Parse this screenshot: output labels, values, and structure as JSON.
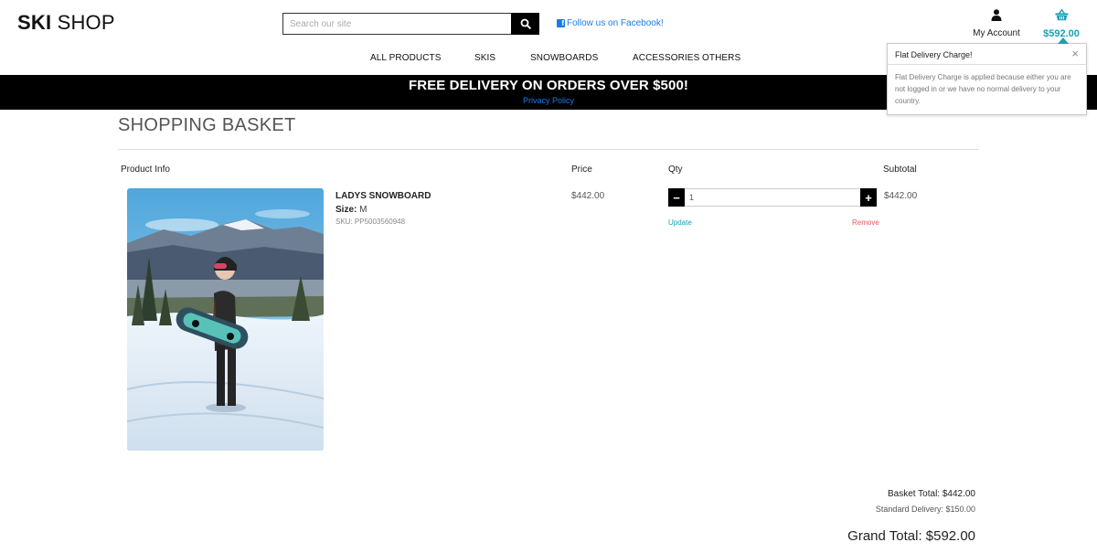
{
  "header": {
    "logo_bold": "SKI",
    "logo_normal": "SHOP",
    "search_placeholder": "Search our site",
    "facebook_label": "Follow us on Facebook!",
    "account_label": "My Account",
    "basket_total": "$592.00"
  },
  "nav": {
    "items": [
      "ALL PRODUCTS",
      "SKIS",
      "SNOWBOARDS",
      "ACCESSORIES",
      "OTHERS"
    ]
  },
  "banner": {
    "message": "FREE DELIVERY ON ORDERS OVER $500!",
    "link": "Privacy Policy"
  },
  "toast": {
    "title": "Flat Delivery Charge!",
    "close": "×",
    "body": "Flat Delivery Charge is applied because either you are not logged in or we have no normal delivery to your country."
  },
  "page": {
    "title": "SHOPPING BASKET"
  },
  "table": {
    "headers": {
      "product": "Product Info",
      "price": "Price",
      "qty": "Qty",
      "subtotal": "Subtotal"
    }
  },
  "item": {
    "name": "LADYS SNOWBOARD",
    "size_label": "Size:",
    "size_value": "M",
    "sku": "SKU: PP5003560948",
    "price": "$442.00",
    "quantity": "1",
    "minus": "−",
    "plus": "+",
    "update_label": "Update",
    "remove_label": "Remove",
    "subtotal": "$442.00"
  },
  "summary": {
    "basket_total": "Basket Total: $442.00",
    "delivery": "Standard Delivery: $150.00",
    "grand_total": "Grand Total: $592.00"
  },
  "colors": {
    "accent": "#1a9fb5",
    "link_blue": "#1a7ce8",
    "remove_red": "#e05a5a",
    "banner_bg": "#000000"
  }
}
